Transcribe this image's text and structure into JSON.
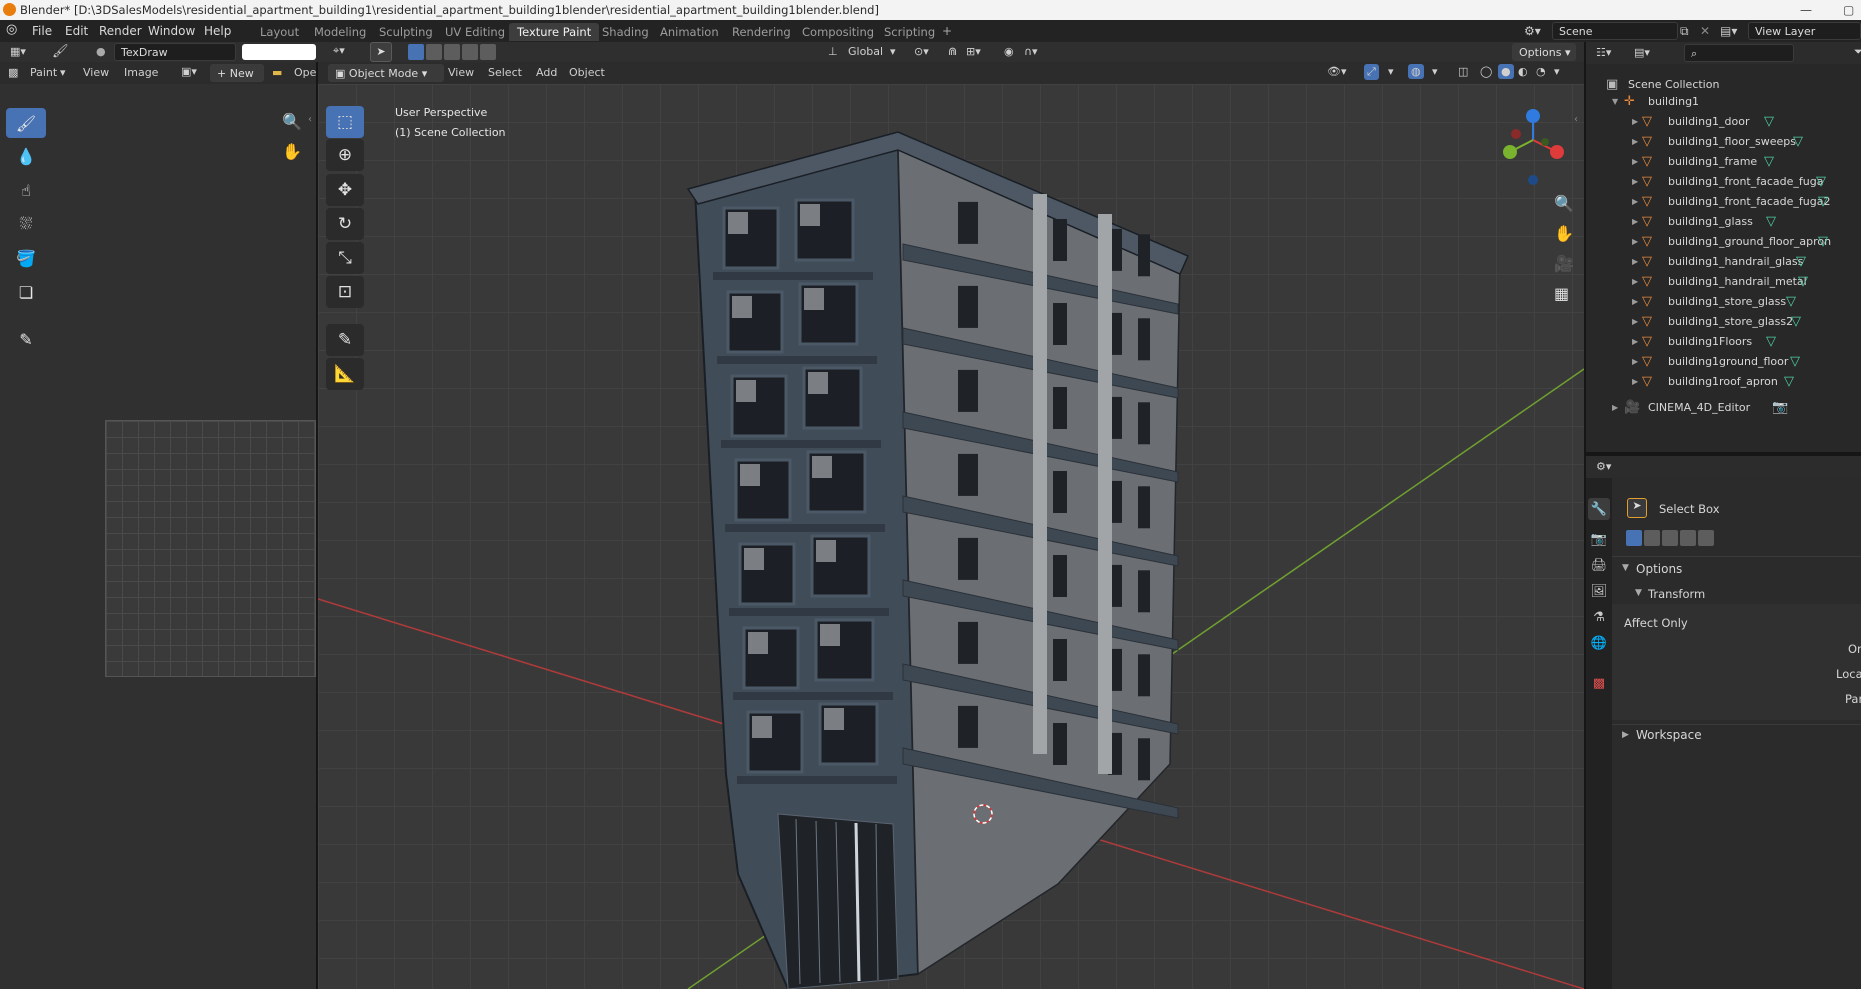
{
  "window": {
    "title": "Blender* [D:\\3DSalesModels\\residential_apartment_building1\\residential_apartment_building1blender\\residential_apartment_building1blender.blend]"
  },
  "menu": [
    "File",
    "Edit",
    "Render",
    "Window",
    "Help"
  ],
  "workspaces": [
    "Layout",
    "Modeling",
    "Sculpting",
    "UV Editing",
    "Texture Paint",
    "Shading",
    "Animation",
    "Rendering",
    "Compositing",
    "Scripting"
  ],
  "active_workspace": "Texture Paint",
  "scene": {
    "name": "Scene",
    "view_layer": "View Layer"
  },
  "tool_header": {
    "brush_name": "TexDraw"
  },
  "image_editor": {
    "mode": "Paint",
    "menus": [
      "View",
      "Image"
    ],
    "new_label": "New",
    "open_label": "Ope"
  },
  "viewport": {
    "mode": "Object Mode",
    "menus": [
      "View",
      "Select",
      "Add",
      "Object"
    ],
    "orientation": "Global",
    "options_label": "Options",
    "overlay_line1": "User Perspective",
    "overlay_line2": "(1) Scene Collection"
  },
  "outliner": {
    "root": "Scene Collection",
    "parent": "building1",
    "children": [
      "building1_door",
      "building1_floor_sweeps",
      "building1_frame",
      "building1_front_facade_fuga",
      "building1_front_facade_fuga2",
      "building1_glass",
      "building1_ground_floor_apron",
      "building1_handrail_glass",
      "building1_handrail_metal",
      "building1_store_glass",
      "building1_store_glass2",
      "building1Floors",
      "building1ground_floor",
      "building1roof_apron"
    ],
    "extra": "CINEMA_4D_Editor"
  },
  "properties": {
    "tool_name": "Select Box",
    "options_label": "Options",
    "transform_label": "Transform",
    "affect_only_label": "Affect Only",
    "affect_items": [
      "Or",
      "Loca",
      "Par"
    ],
    "workspace_label": "Workspace"
  },
  "colors": {
    "accent_blue": "#4772b3",
    "mesh_orange": "#e88a3a",
    "vertex_green": "#4fd1a0",
    "x_axis": "#c43b3b",
    "y_axis": "#7ab32e"
  }
}
